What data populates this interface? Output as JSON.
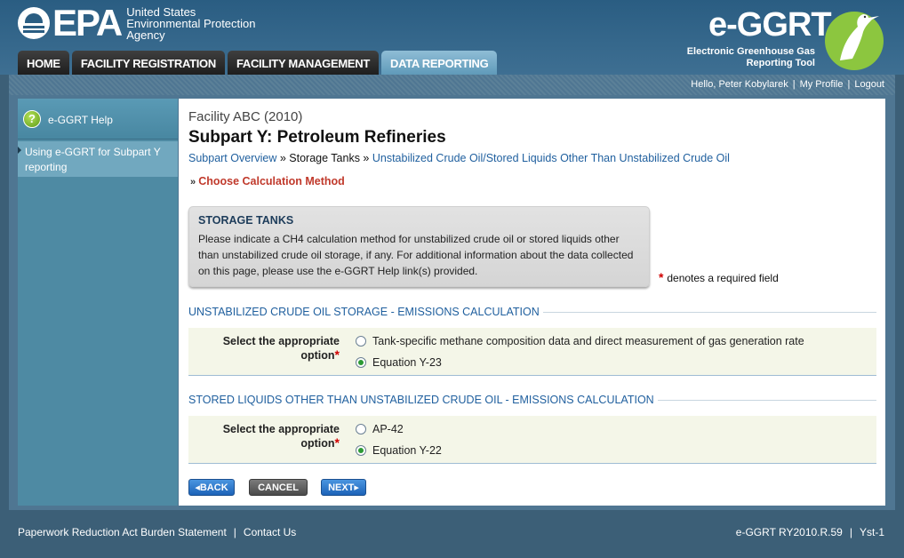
{
  "header": {
    "epa_word": "EPA",
    "agency_lines": [
      "United States",
      "Environmental Protection",
      "Agency"
    ],
    "app_title": "e-GGRT",
    "app_subtitle_lines": [
      "Electronic Greenhouse Gas",
      "Reporting Tool"
    ]
  },
  "tabs": [
    {
      "label": "HOME"
    },
    {
      "label": "FACILITY REGISTRATION"
    },
    {
      "label": "FACILITY MANAGEMENT"
    },
    {
      "label": "DATA REPORTING",
      "active": true
    }
  ],
  "userbar": {
    "greeting": "Hello, Peter Kobylarek",
    "my_profile": "My Profile",
    "logout": "Logout"
  },
  "sidebar": {
    "help_title": "e-GGRT Help",
    "help_link": "Using e-GGRT for Subpart Y reporting"
  },
  "main": {
    "facility": "Facility ABC (2010)",
    "subpart_title": "Subpart Y: Petroleum Refineries",
    "breadcrumb": {
      "overview": "Subpart Overview",
      "sep1": " » ",
      "storage": "Storage Tanks",
      "sep2": " » ",
      "current": "Unstabilized Crude Oil/Stored Liquids Other Than Unstabilized Crude Oil"
    },
    "step": "Choose Calculation Method",
    "infobox": {
      "title": "STORAGE TANKS",
      "text": "Please indicate a CH4 calculation method for unstabilized crude oil or stored liquids other than unstabilized crude oil storage, if any. For additional information about the data collected on this page, please use the e-GGRT Help link(s) provided."
    },
    "required_note": "denotes a required field",
    "sections": [
      {
        "heading": "UNSTABILIZED CRUDE OIL STORAGE - EMISSIONS CALCULATION",
        "label": "Select the appropriate option",
        "options": [
          {
            "label": "Tank-specific methane composition data and direct measurement of gas generation rate",
            "checked": false
          },
          {
            "label": "Equation Y-23",
            "checked": true
          }
        ]
      },
      {
        "heading": "STORED LIQUIDS OTHER THAN UNSTABILIZED CRUDE OIL - EMISSIONS CALCULATION",
        "label": "Select the appropriate option",
        "options": [
          {
            "label": "AP-42",
            "checked": false
          },
          {
            "label": "Equation Y-22",
            "checked": true
          }
        ]
      }
    ],
    "buttons": {
      "back": "◂BACK",
      "cancel": "CANCEL",
      "next": "NEXT▸"
    }
  },
  "footer": {
    "paperwork": "Paperwork Reduction Act Burden Statement",
    "contact": "Contact Us",
    "version": "e-GGRT RY2010.R.59",
    "server": "Yst-1"
  },
  "colors": {
    "header_bg": "#36688c",
    "active_tab": "#6fa7c6",
    "link": "#1f5f9e",
    "step": "#c0392b",
    "required": "#d10000",
    "radio_checked": "#2c9a35"
  }
}
